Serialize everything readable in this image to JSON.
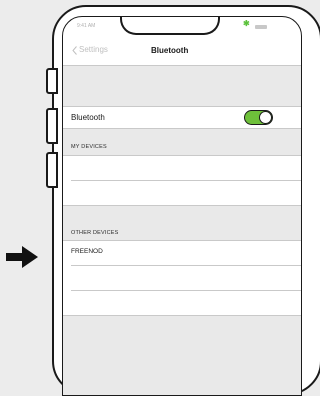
{
  "status_bar": {
    "time": "9:41 AM",
    "bluetooth_symbol": "✱"
  },
  "nav": {
    "back_label": "Settings",
    "title": "Bluetooth",
    "back_icon": "chevron-left-icon"
  },
  "bluetooth_row": {
    "label": "Bluetooth",
    "toggle_on": true
  },
  "my_devices": {
    "header": "MY DEVICES",
    "items": [
      "",
      ""
    ]
  },
  "other_devices": {
    "header": "OTHER DEVICES",
    "items": [
      "FREENOD",
      "",
      ""
    ]
  },
  "colors": {
    "toggle_on": "#6ec03a",
    "bluetooth_status": "#5cc23c",
    "band": "#e9e9e9"
  }
}
